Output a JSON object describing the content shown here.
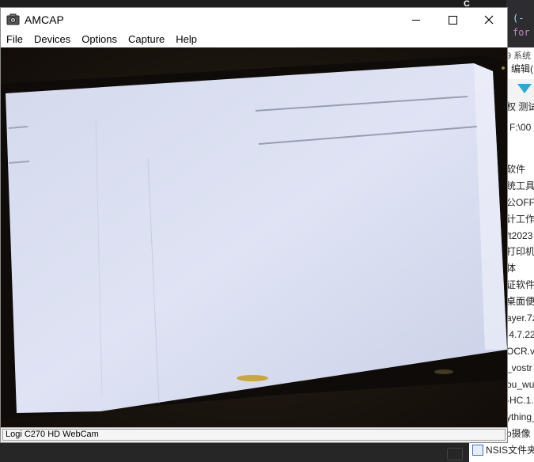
{
  "window": {
    "title": "AMCAP",
    "menu": [
      "File",
      "Devices",
      "Options",
      "Capture",
      "Help"
    ],
    "status_text": "Logi C270 HD WebCam"
  },
  "background": {
    "top_letter": "C",
    "code_lines": [
      "(-",
      "for"
    ],
    "system_label": "9 系统",
    "edit_menu": "编辑(",
    "toolbar_text": "权 测试",
    "path": "F:\\00",
    "file_items": [
      "软件",
      "统工具",
      "公OFF",
      "计工作",
      "ft2023",
      "打印机",
      "体",
      "证软件",
      "桌面便",
      "ayer.7z",
      ".4.7.22",
      "OCR.v",
      "_vostr",
      "ou_wub",
      "-HC.1.",
      "ything_",
      "p摄像"
    ],
    "bottom_folder": "NSIS文件夹"
  },
  "colors": {
    "window_bg": "#ffffff",
    "screen_glow": "#dfe3f4",
    "accent_icon": "#2aa8d8"
  }
}
